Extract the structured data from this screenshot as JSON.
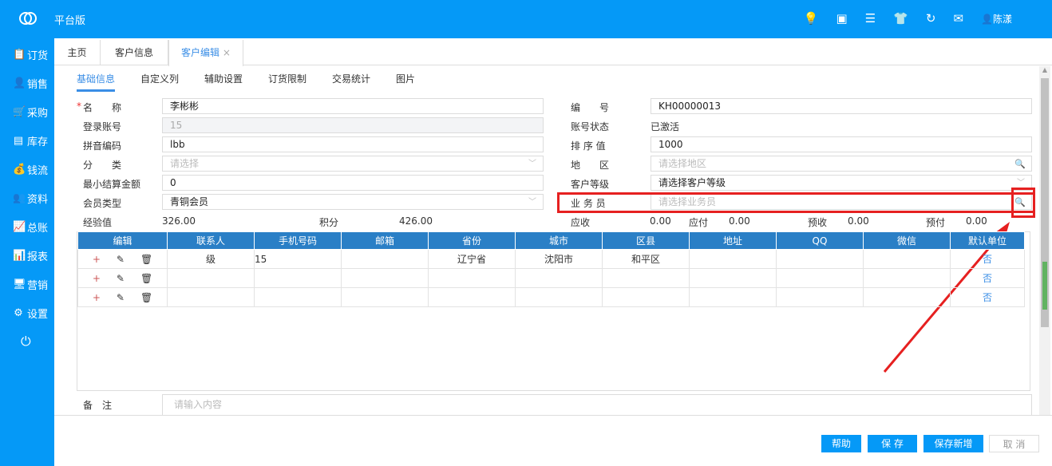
{
  "header": {
    "brand": "平台版",
    "user": "陈漾",
    "icons": [
      "bulb-icon",
      "clipboard-icon",
      "menu-icon",
      "shirt-icon",
      "refresh-icon",
      "mail-icon",
      "user-icon"
    ]
  },
  "sidebar": {
    "items": [
      {
        "label": "订货",
        "icon": "📋"
      },
      {
        "label": "销售",
        "icon": "👤"
      },
      {
        "label": "采购",
        "icon": "🛒"
      },
      {
        "label": "库存",
        "icon": "▤"
      },
      {
        "label": "钱流",
        "icon": "💰"
      },
      {
        "label": "资料",
        "icon": "👥"
      },
      {
        "label": "总账",
        "icon": "📈"
      },
      {
        "label": "报表",
        "icon": "📊"
      },
      {
        "label": "营销",
        "icon": "🖥"
      },
      {
        "label": "设置",
        "icon": "⚙"
      }
    ]
  },
  "tabs": [
    {
      "label": "主页"
    },
    {
      "label": "客户信息"
    },
    {
      "label": "客户编辑",
      "close": "×"
    }
  ],
  "subtabs": [
    "基础信息",
    "自定义列",
    "辅助设置",
    "订货限制",
    "交易统计",
    "图片"
  ],
  "form": {
    "name_label": "名　　称",
    "name": "李彬彬",
    "login_label": "登录账号",
    "login": "15",
    "pinyin_label": "拼音编码",
    "pinyin": "lbb",
    "category_label": "分　　类",
    "category_ph": "请选择",
    "min_label": "最小结算金额",
    "min": "0",
    "member_label": "会员类型",
    "member": "青铜会员",
    "exp_label": "经验值",
    "exp": "326.00",
    "points_label": "积分",
    "points": "426.00",
    "code_label": "编　　号",
    "code": "KH00000013",
    "status_label": "账号状态",
    "status": "已激活",
    "sort_label": "排 序 值",
    "sort": "1000",
    "region_label": "地　　区",
    "region_ph": "请选择地区",
    "level_label": "客户等级",
    "level": "请选择客户等级",
    "sales_label": "业 务 员",
    "sales_ph": "请选择业务员",
    "ar_label": "应收",
    "ar": "0.00",
    "ap_label": "应付",
    "ap": "0.00",
    "pr_label": "预收",
    "pr": "0.00",
    "pp_label": "预付",
    "pp": "0.00",
    "remark_label": "备　注",
    "remark_ph": "请输入内容"
  },
  "table": {
    "headers": [
      "编辑",
      "联系人",
      "手机号码",
      "邮箱",
      "省份",
      "城市",
      "区县",
      "地址",
      "QQ",
      "微信",
      "默认单位"
    ],
    "rows": [
      [
        "级",
        "15",
        "",
        "辽宁省",
        "沈阳市",
        "和平区",
        "",
        "",
        "",
        "否"
      ],
      [
        "",
        "",
        "",
        "",
        "",
        "",
        "",
        "",
        "",
        "否"
      ],
      [
        "",
        "",
        "",
        "",
        "",
        "",
        "",
        "",
        "",
        "否"
      ]
    ]
  },
  "buttons": {
    "help": "帮助",
    "save": "保 存",
    "save_new": "保存新增",
    "cancel": "取 消"
  }
}
